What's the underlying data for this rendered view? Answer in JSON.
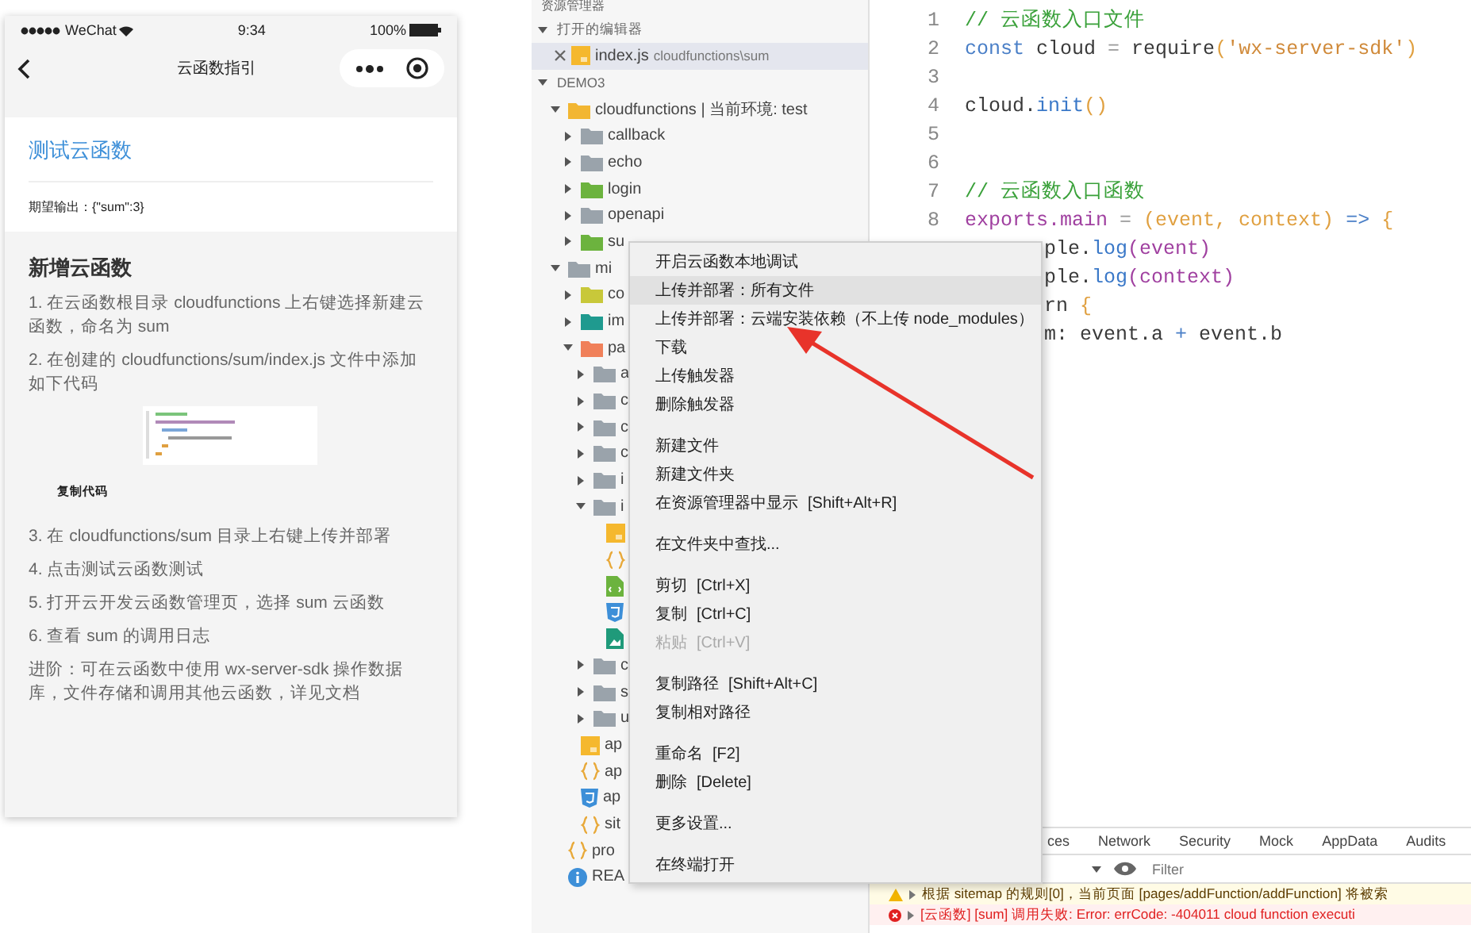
{
  "phone": {
    "status": {
      "carrier": "WeChat",
      "time": "9:34",
      "battery": "100%"
    },
    "nav_title": "云函数指引",
    "test_card": {
      "link": "测试云函数",
      "expected": "期望输出：{\"sum\":3}"
    },
    "heading": "新增云函数",
    "blocks": [
      {
        "kind": "step",
        "text": "1. 在云函数根目录 cloudfunctions 上右键选择新建云函数，命名为 sum"
      },
      {
        "kind": "step",
        "text": "2. 在创建的 cloudfunctions/sum/index.js 文件中添加如下代码"
      },
      {
        "kind": "code-image"
      },
      {
        "kind": "copy-button",
        "text": "复制代码"
      },
      {
        "kind": "step",
        "text": "3. 在 cloudfunctions/sum 目录上右键上传并部署"
      },
      {
        "kind": "step",
        "text": "4. 点击测试云函数测试"
      },
      {
        "kind": "step",
        "text": "5. 打开云开发云函数管理页，选择 sum 云函数"
      },
      {
        "kind": "step",
        "text": "6. 查看 sum 的调用日志"
      },
      {
        "kind": "step",
        "text": "进阶：可在云函数中使用 wx-server-sdk 操作数据库，文件存储和调用其他云函数，详见文档"
      }
    ]
  },
  "explorer": {
    "title": "资源管理器",
    "open_editors": {
      "title": "打开的编辑器",
      "expanded": true,
      "items": [
        {
          "name": "index.js",
          "path": "cloudfunctions\\sum",
          "selected": true
        }
      ]
    },
    "project": {
      "title": "DEMO3",
      "expanded": true,
      "children": [
        {
          "label": "cloudfunctions | 当前环境: test",
          "kind": "folder",
          "color": "#f2b632",
          "expanded": true,
          "children": [
            {
              "label": "callback",
              "kind": "folder",
              "color": "#9aa3ab",
              "expanded": false
            },
            {
              "label": "echo",
              "kind": "folder",
              "color": "#9aa3ab",
              "expanded": false
            },
            {
              "label": "login",
              "kind": "folder",
              "color": "#6cb33e",
              "expanded": false
            },
            {
              "label": "openapi",
              "kind": "folder",
              "color": "#9aa3ab",
              "expanded": false
            },
            {
              "label": "su",
              "kind": "folder",
              "color": "#6cb33e",
              "expanded": false
            }
          ]
        },
        {
          "label": "mi",
          "kind": "folder",
          "color": "#9aa3ab",
          "expanded": true,
          "children": [
            {
              "label": "co",
              "kind": "folder",
              "color": "#c8c83a",
              "expanded": false
            },
            {
              "label": "im",
              "kind": "folder",
              "color": "#1f9a8f",
              "expanded": false
            },
            {
              "label": "pa",
              "kind": "folder",
              "color": "#f0805a",
              "expanded": true,
              "children": [
                {
                  "label": "a",
                  "kind": "folder",
                  "color": "#9aa3ab",
                  "expanded": false
                },
                {
                  "label": "c",
                  "kind": "folder",
                  "color": "#9aa3ab",
                  "expanded": false
                },
                {
                  "label": "c",
                  "kind": "folder",
                  "color": "#9aa3ab",
                  "expanded": false
                },
                {
                  "label": "c",
                  "kind": "folder",
                  "color": "#9aa3ab",
                  "expanded": false
                },
                {
                  "label": "i",
                  "kind": "folder",
                  "color": "#9aa3ab",
                  "expanded": false
                },
                {
                  "label": "i",
                  "kind": "folder",
                  "color": "#9aa3ab",
                  "expanded": true,
                  "children": [
                    {
                      "kind": "js"
                    },
                    {
                      "kind": "json"
                    },
                    {
                      "kind": "wxml"
                    },
                    {
                      "kind": "wxss"
                    },
                    {
                      "kind": "image"
                    }
                  ]
                },
                {
                  "label": "c",
                  "kind": "folder",
                  "color": "#9aa3ab",
                  "expanded": false
                },
                {
                  "label": "s",
                  "kind": "folder",
                  "color": "#9aa3ab",
                  "expanded": false
                },
                {
                  "label": "u",
                  "kind": "folder",
                  "color": "#9aa3ab",
                  "expanded": false
                }
              ]
            },
            {
              "label": "ap",
              "kind": "js"
            },
            {
              "label": "ap",
              "kind": "json"
            },
            {
              "label": "ap",
              "kind": "wxss"
            },
            {
              "label": "sit",
              "kind": "json"
            }
          ]
        },
        {
          "label": "pro",
          "kind": "json"
        },
        {
          "label": "REA",
          "kind": "info"
        }
      ]
    }
  },
  "editor": {
    "lines": [
      {
        "number": "1",
        "tokens": [
          {
            "kind": "comment",
            "text": "// 云函数入口文件"
          }
        ]
      },
      {
        "number": "2",
        "tokens": [
          {
            "kind": "keyword",
            "text": "const"
          },
          {
            "kind": "plain",
            "text": " cloud "
          },
          {
            "kind": "op",
            "text": "="
          },
          {
            "kind": "plain",
            "text": " require"
          },
          {
            "kind": "paren",
            "text": "("
          },
          {
            "kind": "string",
            "text": "'wx-server-sdk'"
          },
          {
            "kind": "paren",
            "text": ")"
          }
        ]
      },
      {
        "number": "3"
      },
      {
        "number": "4",
        "tokens": [
          {
            "kind": "plain",
            "text": "cloud."
          },
          {
            "kind": "method",
            "text": "init"
          },
          {
            "kind": "paren",
            "text": "()"
          }
        ]
      },
      {
        "number": "5"
      },
      {
        "number": "6"
      },
      {
        "number": "7",
        "tokens": [
          {
            "kind": "comment",
            "text": "// 云函数入口函数"
          }
        ]
      },
      {
        "number": "8",
        "tokens": [
          {
            "kind": "member",
            "text": "exports.main"
          },
          {
            "kind": "op",
            "text": " = "
          },
          {
            "kind": "paren",
            "text": "(event, context)"
          },
          {
            "kind": "keyword",
            "text": " => "
          },
          {
            "kind": "paren",
            "text": "{"
          }
        ]
      },
      {
        "tokens": [
          {
            "kind": "plain",
            "text": "ple."
          },
          {
            "kind": "method",
            "text": "log"
          },
          {
            "kind": "member",
            "text": "(event)"
          }
        ]
      },
      {
        "tokens": [
          {
            "kind": "plain",
            "text": "ple."
          },
          {
            "kind": "method",
            "text": "log"
          },
          {
            "kind": "member",
            "text": "(context)"
          }
        ]
      },
      {
        "tokens": [
          {
            "kind": "plain",
            "text": "rn "
          },
          {
            "kind": "paren",
            "text": "{"
          }
        ]
      },
      {
        "tokens": [
          {
            "kind": "plain",
            "text": "m: event.a "
          },
          {
            "kind": "keyword",
            "text": "+"
          },
          {
            "kind": "plain",
            "text": " event.b"
          }
        ]
      }
    ]
  },
  "devtools": {
    "tabs": [
      {
        "label": "ces",
        "selected": false
      },
      {
        "label": "Network",
        "selected": false
      },
      {
        "label": "Security",
        "selected": false
      },
      {
        "label": "Mock",
        "selected": false
      },
      {
        "label": "AppData",
        "selected": false
      },
      {
        "label": "Audits",
        "selected": false
      }
    ],
    "filter": {
      "placeholder": "Filter"
    },
    "console": [
      {
        "kind": "warning",
        "text": "根据 sitemap 的规则[0]，当前页面 [pages/addFunction/addFunction] 将被索"
      },
      {
        "kind": "error",
        "text": "[云函数] [sum] 调用失败: Error: errCode: -404011 cloud function executi"
      }
    ]
  },
  "menu": {
    "groups": [
      {
        "items": [
          {
            "label": "开启云函数本地调试",
            "selected": false,
            "disabled": false
          },
          {
            "label": "上传并部署：所有文件",
            "selected": true,
            "disabled": false
          },
          {
            "label": "上传并部署：云端安装依赖（不上传 node_modules）",
            "selected": false,
            "disabled": false
          },
          {
            "label": "下载",
            "selected": false,
            "disabled": false
          },
          {
            "label": "上传触发器",
            "selected": false,
            "disabled": false
          },
          {
            "label": "删除触发器",
            "selected": false,
            "disabled": false
          }
        ]
      },
      {
        "items": [
          {
            "label": "新建文件",
            "selected": false,
            "disabled": false
          },
          {
            "label": "新建文件夹",
            "selected": false,
            "disabled": false
          },
          {
            "label": "在资源管理器中显示",
            "shortcut": "[Shift+Alt+R]",
            "selected": false,
            "disabled": false
          }
        ]
      },
      {
        "items": [
          {
            "label": "在文件夹中查找...",
            "selected": false,
            "disabled": false
          }
        ]
      },
      {
        "items": [
          {
            "label": "剪切",
            "shortcut": "[Ctrl+X]",
            "selected": false,
            "disabled": false
          },
          {
            "label": "复制",
            "shortcut": "[Ctrl+C]",
            "selected": false,
            "disabled": false
          },
          {
            "label": "粘贴",
            "shortcut": "[Ctrl+V]",
            "selected": false,
            "disabled": true
          }
        ]
      },
      {
        "items": [
          {
            "label": "复制路径",
            "shortcut": "[Shift+Alt+C]",
            "selected": false,
            "disabled": false
          },
          {
            "label": "复制相对路径",
            "selected": false,
            "disabled": false
          }
        ]
      },
      {
        "items": [
          {
            "label": "重命名",
            "shortcut": "[F2]",
            "selected": false,
            "disabled": false
          },
          {
            "label": "删除",
            "shortcut": "[Delete]",
            "selected": false,
            "disabled": false
          }
        ]
      },
      {
        "items": [
          {
            "label": "更多设置...",
            "selected": false,
            "disabled": false
          }
        ]
      },
      {
        "items": [
          {
            "label": "在终端打开",
            "selected": false,
            "disabled": false
          }
        ]
      }
    ]
  }
}
